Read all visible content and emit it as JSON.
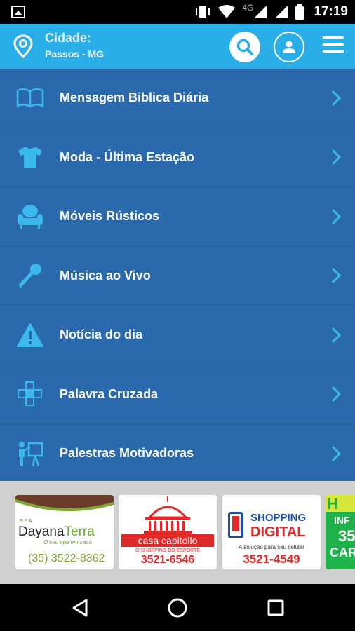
{
  "status_bar": {
    "time": "17:19",
    "network": "4G"
  },
  "header": {
    "city_label": "Cidade:",
    "city_value": "Passos - MG",
    "icons": [
      "location-pin-icon",
      "search-icon",
      "profile-icon",
      "hamburger-menu-icon"
    ]
  },
  "menu": {
    "items": [
      {
        "label": "Mensagem Biblica Diária",
        "icon": "book-icon"
      },
      {
        "label": "Moda - Última Estação",
        "icon": "tshirt-icon"
      },
      {
        "label": "Móveis Rústicos",
        "icon": "armchair-icon"
      },
      {
        "label": "Música ao Vivo",
        "icon": "microphone-icon"
      },
      {
        "label": "Notícia do dia",
        "icon": "warning-icon"
      },
      {
        "label": "Palavra Cruzada",
        "icon": "crossword-icon"
      },
      {
        "label": "Palestras Motivadoras",
        "icon": "presenter-icon"
      }
    ]
  },
  "ads": {
    "dayana": {
      "prefix": "SPA",
      "brand_a": "Dayana",
      "brand_b": "Terra",
      "slogan": "O seu spa em casa",
      "phone": "(35) 3522-8362"
    },
    "capitolio": {
      "name": "casa capitollo",
      "sub": "O SHOPPING DO ESPORTE",
      "phone": "3521-6546"
    },
    "shopping": {
      "line1": "SHOPPING",
      "line2": "DIGITAL",
      "sub": "A solução para seu celular",
      "phone": "3521-4549"
    },
    "partial": {
      "top": "H",
      "line1": "INF",
      "line2": "35",
      "line3": "CAR"
    }
  },
  "colors": {
    "header": "#2aaee8",
    "list_bg": "#2a6aac",
    "accent": "#3bb8ee",
    "ad_strip": "#cfcfcf"
  }
}
